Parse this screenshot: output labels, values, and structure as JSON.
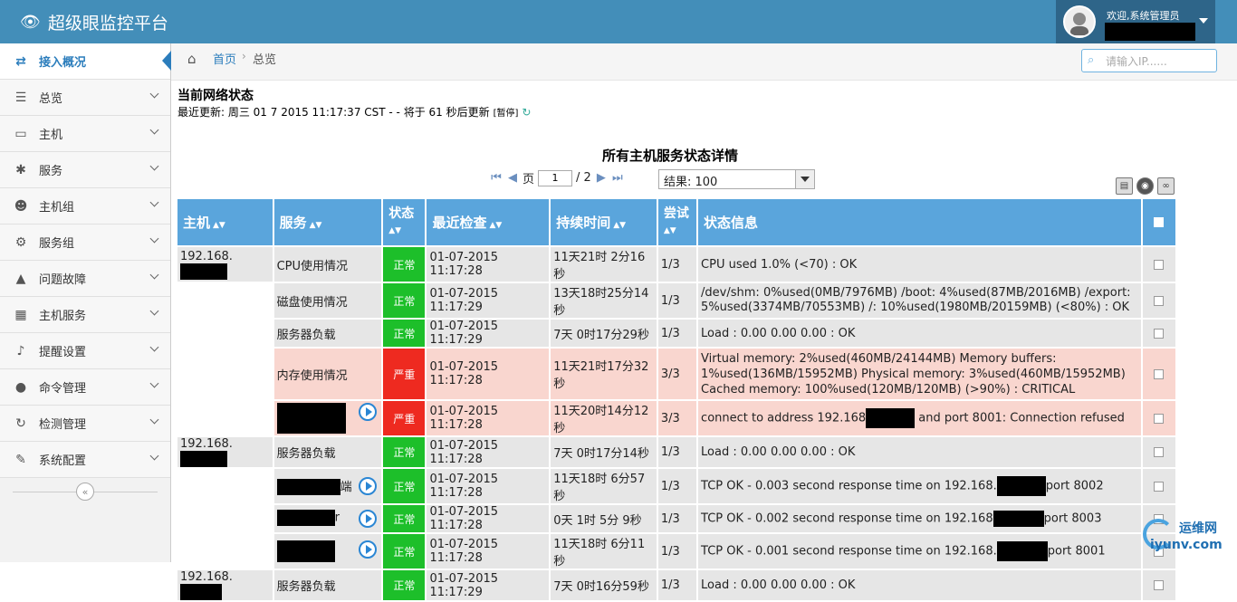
{
  "app": {
    "title": "超级眼监控平台",
    "eye_icon": "eye-icon"
  },
  "user": {
    "welcome": "欢迎,系统管理员"
  },
  "sidebar": {
    "items": [
      {
        "label": "接入概况",
        "icon": "exchange-icon",
        "active": true
      },
      {
        "label": "总览",
        "icon": "list-icon"
      },
      {
        "label": "主机",
        "icon": "desktop-icon"
      },
      {
        "label": "服务",
        "icon": "gear-icon"
      },
      {
        "label": "主机组",
        "icon": "users-icon"
      },
      {
        "label": "服务组",
        "icon": "gears-icon"
      },
      {
        "label": "问题故障",
        "icon": "warning-icon"
      },
      {
        "label": "主机服务",
        "icon": "grid-icon"
      },
      {
        "label": "提醒设置",
        "icon": "bell-icon"
      },
      {
        "label": "命令管理",
        "icon": "chat-icon"
      },
      {
        "label": "检测管理",
        "icon": "refresh-icon"
      },
      {
        "label": "系统配置",
        "icon": "wrench-icon"
      }
    ],
    "collapse_glyph": "«"
  },
  "breadcrumb": {
    "home": "首页",
    "separator": "›",
    "current": "总览"
  },
  "search": {
    "placeholder": "请输入IP......"
  },
  "status": {
    "title": "当前网络状态",
    "last_update": "最近更新: 周三 01 7 2015 11:17:37 CST - - 将于 61 秒后更新",
    "pause": "[暂停]"
  },
  "table": {
    "title": "所有主机服务状态详情",
    "pager": {
      "page_label": "页",
      "current_page": "1",
      "total": "/ 2"
    },
    "results_label": "结果: 100",
    "headers": {
      "host": "主机",
      "service": "服务",
      "status": "状态",
      "last_check": "最近检查",
      "duration": "持续时间",
      "attempt": "尝试",
      "info": "状态信息"
    },
    "rows": [
      {
        "host": "192.168.",
        "service": "CPU使用情况",
        "status": "正常",
        "last_check": "01-07-2015 11:17:28",
        "duration": "11天21时 2分16秒",
        "attempt": "1/3",
        "info": "CPU used 1.0% (<70) : OK"
      },
      {
        "host": "",
        "service": "磁盘使用情况",
        "status": "正常",
        "last_check": "01-07-2015 11:17:29",
        "duration": "13天18时25分14秒",
        "attempt": "1/3",
        "info": "/dev/shm: 0%used(0MB/7976MB) /boot: 4%used(87MB/2016MB) /export: 5%used(3374MB/70553MB) /: 10%used(1980MB/20159MB) (<80%) : OK"
      },
      {
        "host": "",
        "service": "服务器负载",
        "status": "正常",
        "last_check": "01-07-2015 11:17:29",
        "duration": "7天 0时17分29秒",
        "attempt": "1/3",
        "info": "Load : 0.00 0.00 0.00 : OK"
      },
      {
        "host": "",
        "service": "内存使用情况",
        "status": "严重",
        "last_check": "01-07-2015 11:17:28",
        "duration": "11天21时17分32秒",
        "attempt": "3/3",
        "info": "Virtual memory: 2%used(460MB/24144MB) Memory buffers: 1%used(136MB/15952MB) Physical memory: 3%used(460MB/15952MB) Cached memory: 100%used(120MB/120MB) (>90%) : CRITICAL"
      },
      {
        "host": "",
        "service": "",
        "status": "严重",
        "last_check": "01-07-2015 11:17:28",
        "duration": "11天20时14分12秒",
        "attempt": "3/3",
        "info_a": "connect to address 192.168",
        "info_b": "and port 8001: Connection refused"
      },
      {
        "host": "192.168.",
        "service": "服务器负载",
        "status": "正常",
        "last_check": "01-07-2015 11:17:28",
        "duration": "7天 0时17分14秒",
        "attempt": "1/3",
        "info": "Load : 0.00 0.00 0.00 : OK"
      },
      {
        "host": "",
        "service_tail": "端",
        "status": "正常",
        "last_check": "01-07-2015 11:17:28",
        "duration": "11天18时 6分57秒",
        "attempt": "1/3",
        "info_a": "TCP OK - 0.003 second response time on 192.168.",
        "info_b": "port 8002"
      },
      {
        "host": "",
        "service_tail": "r",
        "status": "正常",
        "last_check": "01-07-2015 11:17:28",
        "duration": "0天 1时 5分 9秒",
        "attempt": "1/3",
        "info_a": "TCP OK - 0.002 second response time on 192.168",
        "info_b": "port 8003"
      },
      {
        "host": "",
        "service_tail": "",
        "status": "正常",
        "last_check": "01-07-2015 11:17:28",
        "duration": "11天18时 6分11秒",
        "attempt": "1/3",
        "info_a": "TCP OK - 0.001 second response time on 192.168.",
        "info_b": "port 8001"
      },
      {
        "host": "192.168.",
        "service": "服务器负载",
        "status": "正常",
        "last_check": "01-07-2015 11:17:29",
        "duration": "7天 0时16分59秒",
        "attempt": "1/3",
        "info": "Load : 0.00 0.00 0.00 : OK"
      }
    ]
  },
  "watermark": {
    "top": "运维网",
    "bottom": "iyunv.com"
  },
  "colors": {
    "topbar": "#438eb9",
    "header": "#5aa5dc",
    "ok": "#1dbf2a",
    "critical": "#ee2a20",
    "crit_row": "#f9d6cf"
  }
}
